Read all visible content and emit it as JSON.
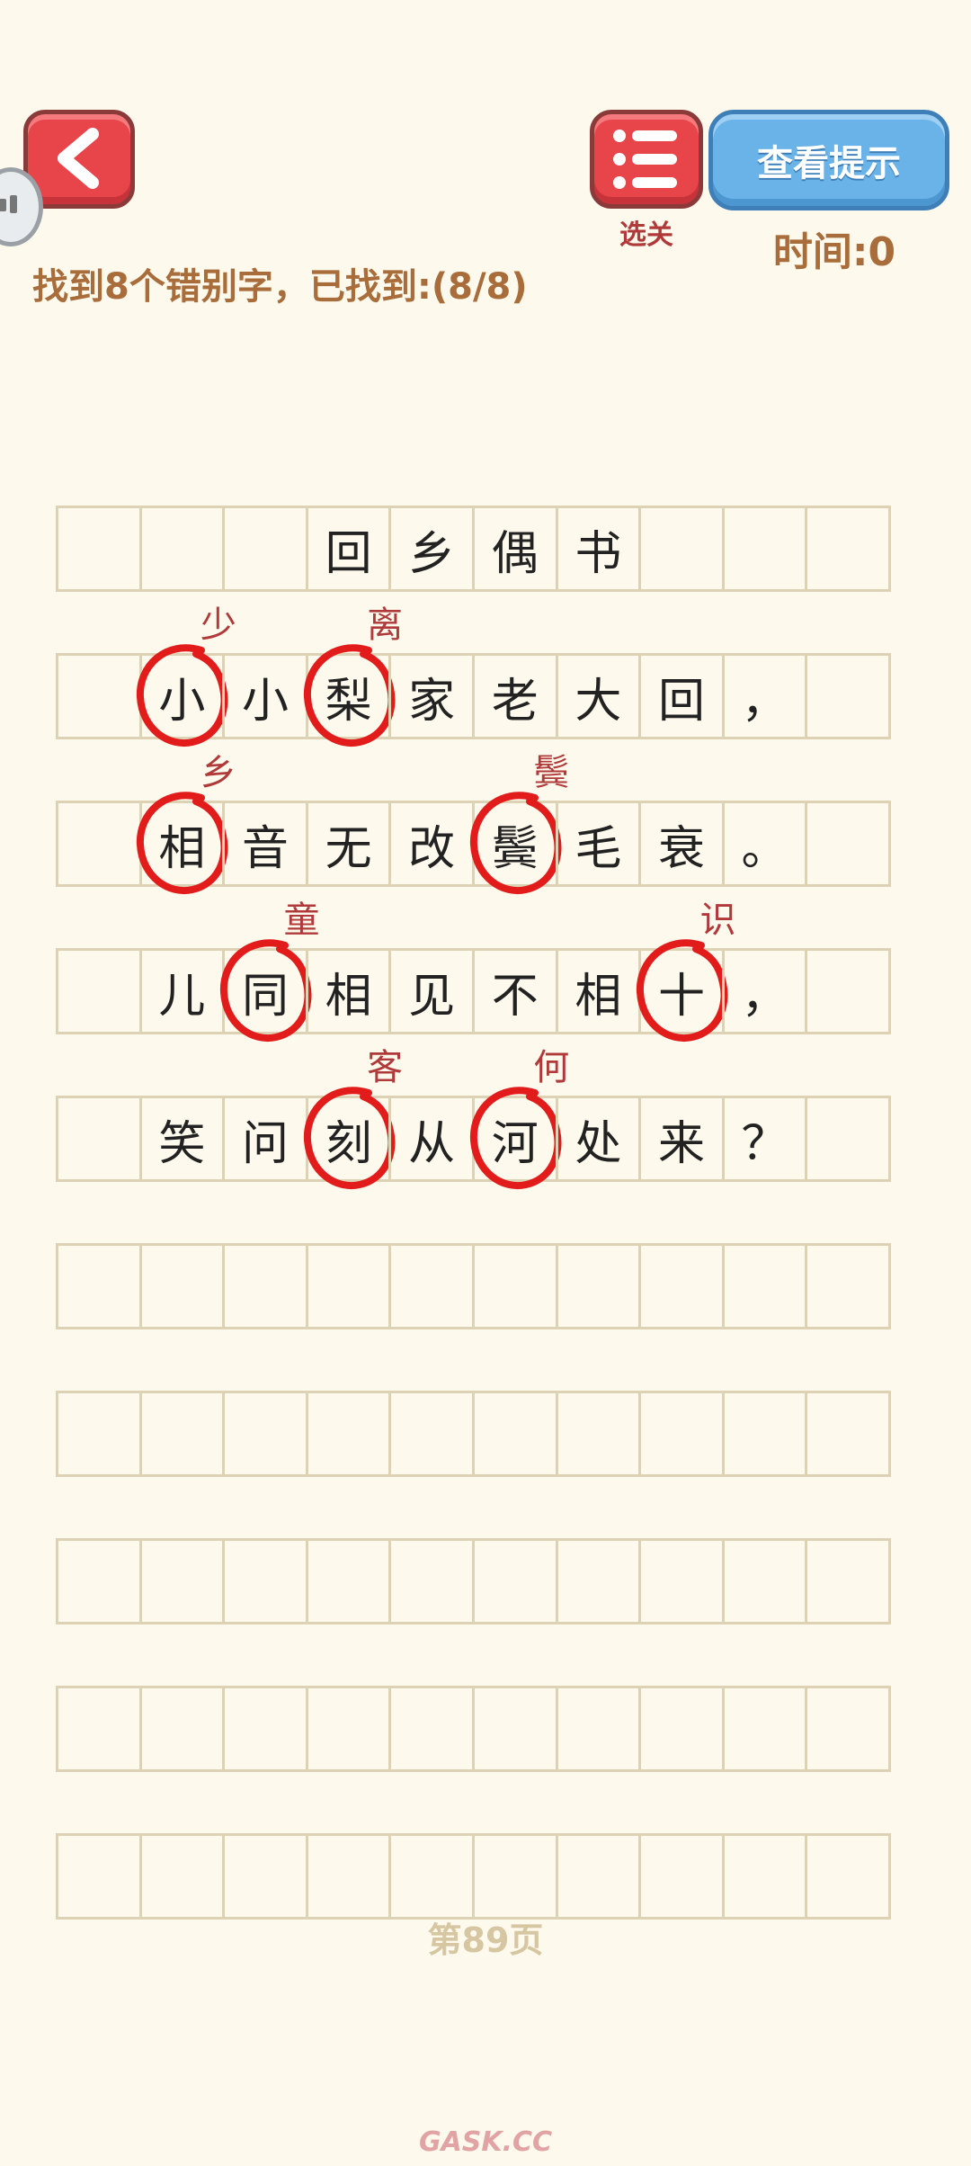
{
  "header": {
    "menu_label": "选关",
    "hint_label": "查看提示",
    "timer": "时间:0"
  },
  "task": "找到8个错别字，已找到:(8/8)",
  "poem": {
    "rows": [
      [
        "",
        "",
        "",
        "回",
        "乡",
        "偶",
        "书",
        "",
        "",
        ""
      ],
      [
        "",
        "小",
        "小",
        "梨",
        "家",
        "老",
        "大",
        "回",
        "，",
        ""
      ],
      [
        "",
        "相",
        "音",
        "无",
        "改",
        "鬓",
        "毛",
        "衰",
        "。",
        ""
      ],
      [
        "",
        "儿",
        "同",
        "相",
        "见",
        "不",
        "相",
        "十",
        "，",
        ""
      ],
      [
        "",
        "笑",
        "问",
        "刻",
        "从",
        "河",
        "处",
        "来",
        "？",
        ""
      ],
      [
        "",
        "",
        "",
        "",
        "",
        "",
        "",
        "",
        "",
        ""
      ],
      [
        "",
        "",
        "",
        "",
        "",
        "",
        "",
        "",
        "",
        ""
      ],
      [
        "",
        "",
        "",
        "",
        "",
        "",
        "",
        "",
        "",
        ""
      ],
      [
        "",
        "",
        "",
        "",
        "",
        "",
        "",
        "",
        "",
        ""
      ],
      [
        "",
        "",
        "",
        "",
        "",
        "",
        "",
        "",
        "",
        ""
      ]
    ]
  },
  "corrections": [
    {
      "row": 1,
      "col": 1,
      "text": "少"
    },
    {
      "row": 1,
      "col": 3,
      "text": "离"
    },
    {
      "row": 2,
      "col": 1,
      "text": "乡"
    },
    {
      "row": 2,
      "col": 5,
      "text": "鬓"
    },
    {
      "row": 3,
      "col": 2,
      "text": "童"
    },
    {
      "row": 3,
      "col": 7,
      "text": "识"
    },
    {
      "row": 4,
      "col": 3,
      "text": "客"
    },
    {
      "row": 4,
      "col": 5,
      "text": "何"
    }
  ],
  "page_number": "第89页",
  "watermark": "GASK.CC",
  "colors": {
    "accent_red": "#e8454b",
    "hint_blue": "#6ab3e8",
    "text_brown": "#a86d3a",
    "correction_red": "#b03a3a",
    "circle_red": "#e21b1b"
  }
}
